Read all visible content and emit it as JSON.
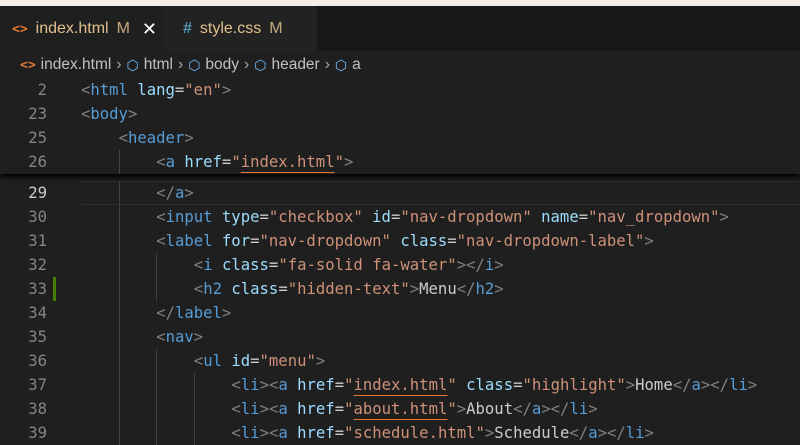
{
  "tabs": [
    {
      "icon": "<>",
      "name": "index.html",
      "status": "M",
      "close": "✕"
    },
    {
      "icon": "#",
      "name": "style.css",
      "status": "M"
    }
  ],
  "breadcrumb": {
    "file": "index.html",
    "items": [
      "html",
      "body",
      "header",
      "a"
    ]
  },
  "colors": {
    "tag": "#569cd6",
    "attr": "#9cdcfe",
    "string": "#ce9178",
    "punct": "#808080",
    "git_modified": "#487e02"
  },
  "sticky_lines": [
    {
      "num": "2",
      "indent": 0,
      "tokens": [
        [
          "p",
          "<"
        ],
        [
          "t",
          "html"
        ],
        [
          "x",
          " "
        ],
        [
          "a",
          "lang"
        ],
        [
          "e",
          "="
        ],
        [
          "s",
          "\"en\""
        ],
        [
          "p",
          ">"
        ]
      ]
    },
    {
      "num": "23",
      "indent": 0,
      "tokens": [
        [
          "p",
          "<"
        ],
        [
          "t",
          "body"
        ],
        [
          "p",
          ">"
        ]
      ]
    },
    {
      "num": "25",
      "indent": 1,
      "tokens": [
        [
          "p",
          "<"
        ],
        [
          "t",
          "header"
        ],
        [
          "p",
          ">"
        ]
      ]
    },
    {
      "num": "26",
      "indent": 2,
      "tokens": [
        [
          "p",
          "<"
        ],
        [
          "t",
          "a"
        ],
        [
          "x",
          " "
        ],
        [
          "a",
          "href"
        ],
        [
          "e",
          "="
        ],
        [
          "s",
          "\""
        ],
        [
          "su",
          "index.html"
        ],
        [
          "s",
          "\""
        ],
        [
          "p",
          ">"
        ]
      ]
    }
  ],
  "lines": [
    {
      "num": "29",
      "indent": 2,
      "current": true,
      "tokens": [
        [
          "p",
          "</"
        ],
        [
          "t",
          "a"
        ],
        [
          "p",
          ">"
        ]
      ]
    },
    {
      "num": "30",
      "indent": 2,
      "tokens": [
        [
          "p",
          "<"
        ],
        [
          "t",
          "input"
        ],
        [
          "x",
          " "
        ],
        [
          "a",
          "type"
        ],
        [
          "e",
          "="
        ],
        [
          "s",
          "\"checkbox\""
        ],
        [
          "x",
          " "
        ],
        [
          "a",
          "id"
        ],
        [
          "e",
          "="
        ],
        [
          "s",
          "\"nav-dropdown\""
        ],
        [
          "x",
          " "
        ],
        [
          "a",
          "name"
        ],
        [
          "e",
          "="
        ],
        [
          "s",
          "\"nav_dropdown\""
        ],
        [
          "p",
          ">"
        ]
      ]
    },
    {
      "num": "31",
      "indent": 2,
      "tokens": [
        [
          "p",
          "<"
        ],
        [
          "t",
          "label"
        ],
        [
          "x",
          " "
        ],
        [
          "a",
          "for"
        ],
        [
          "e",
          "="
        ],
        [
          "s",
          "\"nav-dropdown\""
        ],
        [
          "x",
          " "
        ],
        [
          "a",
          "class"
        ],
        [
          "e",
          "="
        ],
        [
          "s",
          "\"nav-dropdown-label\""
        ],
        [
          "p",
          ">"
        ]
      ]
    },
    {
      "num": "32",
      "indent": 3,
      "tokens": [
        [
          "p",
          "<"
        ],
        [
          "t",
          "i"
        ],
        [
          "x",
          " "
        ],
        [
          "a",
          "class"
        ],
        [
          "e",
          "="
        ],
        [
          "s",
          "\"fa-solid fa-water\""
        ],
        [
          "p",
          "></"
        ],
        [
          "t",
          "i"
        ],
        [
          "p",
          ">"
        ]
      ]
    },
    {
      "num": "33",
      "indent": 3,
      "modified": true,
      "tokens": [
        [
          "p",
          "<"
        ],
        [
          "t",
          "h2"
        ],
        [
          "x",
          " "
        ],
        [
          "a",
          "class"
        ],
        [
          "e",
          "="
        ],
        [
          "s",
          "\"hidden-text\""
        ],
        [
          "p",
          ">"
        ],
        [
          "x",
          "Menu"
        ],
        [
          "p",
          "</"
        ],
        [
          "t",
          "h2"
        ],
        [
          "p",
          ">"
        ]
      ]
    },
    {
      "num": "34",
      "indent": 2,
      "tokens": [
        [
          "p",
          "</"
        ],
        [
          "t",
          "label"
        ],
        [
          "p",
          ">"
        ]
      ]
    },
    {
      "num": "35",
      "indent": 2,
      "tokens": [
        [
          "p",
          "<"
        ],
        [
          "t",
          "nav"
        ],
        [
          "p",
          ">"
        ]
      ]
    },
    {
      "num": "36",
      "indent": 3,
      "tokens": [
        [
          "p",
          "<"
        ],
        [
          "t",
          "ul"
        ],
        [
          "x",
          " "
        ],
        [
          "a",
          "id"
        ],
        [
          "e",
          "="
        ],
        [
          "s",
          "\"menu\""
        ],
        [
          "p",
          ">"
        ]
      ]
    },
    {
      "num": "37",
      "indent": 4,
      "tokens": [
        [
          "p",
          "<"
        ],
        [
          "t",
          "li"
        ],
        [
          "p",
          "><"
        ],
        [
          "t",
          "a"
        ],
        [
          "x",
          " "
        ],
        [
          "a",
          "href"
        ],
        [
          "e",
          "="
        ],
        [
          "s",
          "\""
        ],
        [
          "su",
          "index.html"
        ],
        [
          "s",
          "\""
        ],
        [
          "x",
          " "
        ],
        [
          "a",
          "class"
        ],
        [
          "e",
          "="
        ],
        [
          "s",
          "\"highlight\""
        ],
        [
          "p",
          ">"
        ],
        [
          "x",
          "Home"
        ],
        [
          "p",
          "</"
        ],
        [
          "t",
          "a"
        ],
        [
          "p",
          "></"
        ],
        [
          "t",
          "li"
        ],
        [
          "p",
          ">"
        ]
      ]
    },
    {
      "num": "38",
      "indent": 4,
      "tokens": [
        [
          "p",
          "<"
        ],
        [
          "t",
          "li"
        ],
        [
          "p",
          "><"
        ],
        [
          "t",
          "a"
        ],
        [
          "x",
          " "
        ],
        [
          "a",
          "href"
        ],
        [
          "e",
          "="
        ],
        [
          "s",
          "\""
        ],
        [
          "su",
          "about.html"
        ],
        [
          "s",
          "\""
        ],
        [
          "p",
          ">"
        ],
        [
          "x",
          "About"
        ],
        [
          "p",
          "</"
        ],
        [
          "t",
          "a"
        ],
        [
          "p",
          "></"
        ],
        [
          "t",
          "li"
        ],
        [
          "p",
          ">"
        ]
      ]
    },
    {
      "num": "39",
      "indent": 4,
      "tokens": [
        [
          "p",
          "<"
        ],
        [
          "t",
          "li"
        ],
        [
          "p",
          "><"
        ],
        [
          "t",
          "a"
        ],
        [
          "x",
          " "
        ],
        [
          "a",
          "href"
        ],
        [
          "e",
          "="
        ],
        [
          "s",
          "\"schedule.html\""
        ],
        [
          "p",
          ">"
        ],
        [
          "x",
          "Schedule"
        ],
        [
          "p",
          "</"
        ],
        [
          "t",
          "a"
        ],
        [
          "p",
          "></"
        ],
        [
          "t",
          "li"
        ],
        [
          "p",
          ">"
        ]
      ]
    }
  ]
}
